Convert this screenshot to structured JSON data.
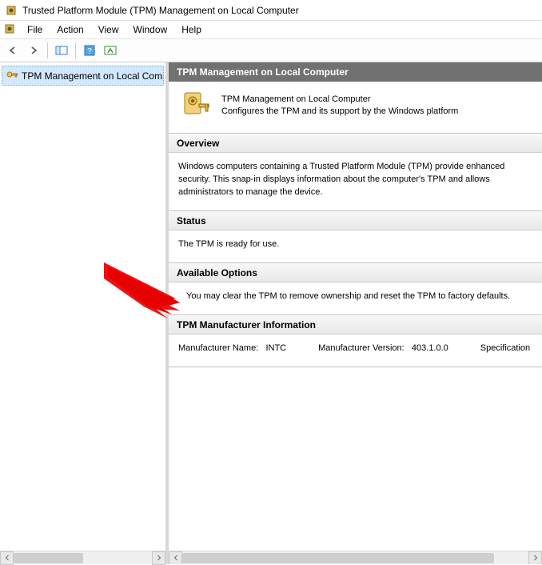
{
  "window": {
    "title": "Trusted Platform Module (TPM) Management on Local Computer"
  },
  "menu": {
    "file": "File",
    "action": "Action",
    "view": "View",
    "window": "Window",
    "help": "Help"
  },
  "tree": {
    "root_label": "TPM Management on Local Comp"
  },
  "content": {
    "header": "TPM Management on Local Computer",
    "intro_title": "TPM Management on Local Computer",
    "intro_sub": "Configures the TPM and its support by the Windows platform",
    "overview": {
      "heading": "Overview",
      "body": "Windows computers containing a Trusted Platform Module (TPM) provide enhanced security. This snap-in displays information about the computer's TPM and allows administrators to manage the device."
    },
    "status": {
      "heading": "Status",
      "body": "The TPM is ready for use."
    },
    "options": {
      "heading": "Available Options",
      "body": "You may clear the TPM to remove ownership and reset the TPM to factory defaults."
    },
    "mfr": {
      "heading": "TPM Manufacturer Information",
      "name_label": "Manufacturer Name:",
      "name_value": "INTC",
      "version_label": "Manufacturer Version:",
      "version_value": "403.1.0.0",
      "spec_label": "Specification Ver"
    }
  }
}
